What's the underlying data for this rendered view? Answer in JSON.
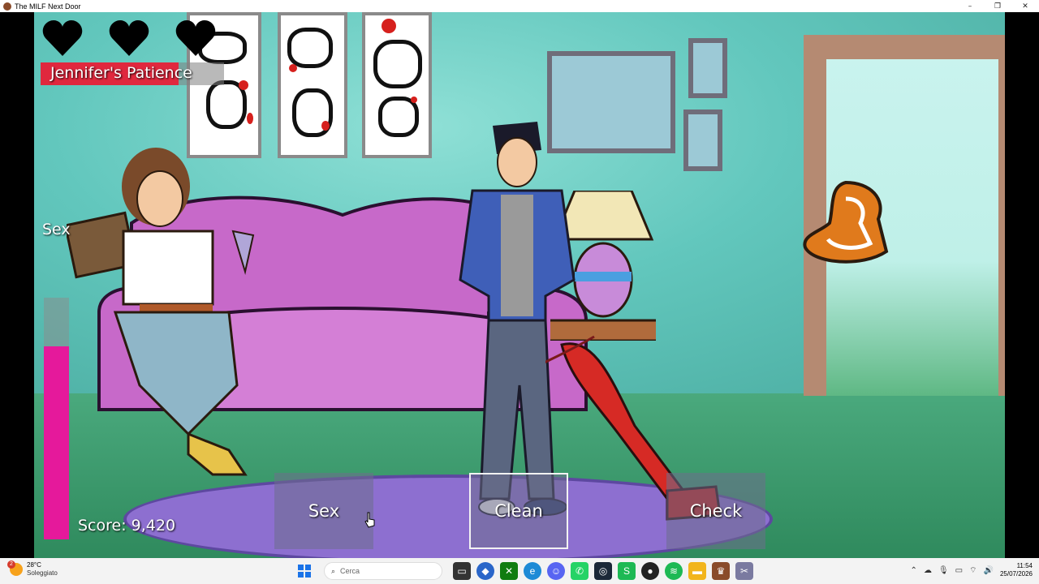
{
  "window": {
    "title": "The MILF Next Door",
    "minimize": "–",
    "maximize": "❐",
    "close": "✕"
  },
  "hud": {
    "hearts": {
      "count": 3,
      "color": "#000000"
    },
    "patience": {
      "label": "Jennifer's Patience",
      "fraction": 0.75,
      "fill_color": "#e0283e"
    },
    "sex_meter": {
      "label": "Sex",
      "fraction": 0.8,
      "fill_color": "#e5199b"
    },
    "score_text": "Score: 9,420"
  },
  "actions": [
    {
      "label": "Sex",
      "selected": false
    },
    {
      "label": "Clean",
      "selected": true
    },
    {
      "label": "Check",
      "selected": false
    }
  ],
  "taskbar": {
    "weather_badge": "2",
    "weather_temp": "28°C",
    "weather_condition": "Soleggiato",
    "search_placeholder": "Cerca",
    "icons": [
      "windows-start-icon",
      "search-icon",
      "task-view-icon",
      "app-icon",
      "xbox-icon",
      "edge-icon",
      "discord-icon",
      "whatsapp-icon",
      "steam-icon",
      "spotify-alt-icon",
      "app-icon",
      "spotify-icon",
      "folder-icon",
      "game-icon",
      "snipping-icon"
    ],
    "time": "11:54",
    "date": "25/07/2026"
  }
}
